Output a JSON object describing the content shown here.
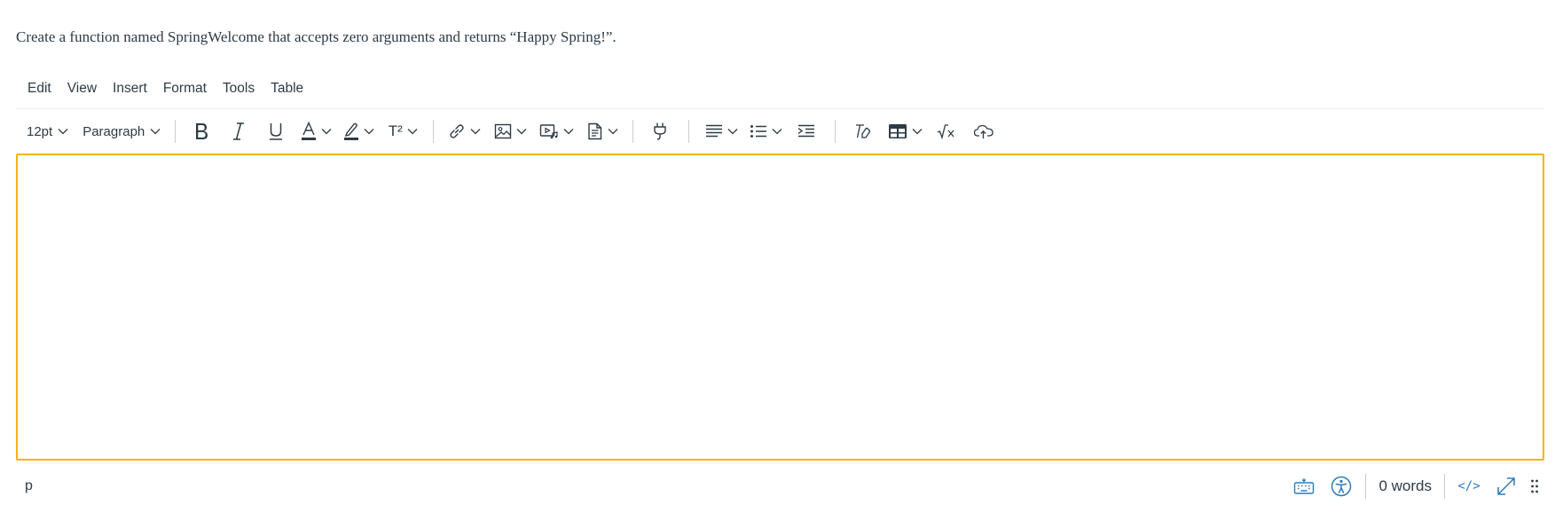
{
  "question": {
    "text": "Create a function named SpringWelcome that accepts zero arguments and returns “Happy Spring!”."
  },
  "menubar": {
    "items": [
      "Edit",
      "View",
      "Insert",
      "Format",
      "Tools",
      "Table"
    ]
  },
  "toolbar": {
    "font_size": "12pt",
    "block_format": "Paragraph",
    "superscript_label": "T²",
    "icons": [
      "bold-icon",
      "italic-icon",
      "underline-icon",
      "text-color-icon",
      "highlight-icon",
      "superscript-icon",
      "link-icon",
      "image-icon",
      "media-icon",
      "document-icon",
      "plug-icon",
      "align-icon",
      "list-icon",
      "indent-icon",
      "clear-format-icon",
      "table-icon",
      "math-icon",
      "cloud-upload-icon"
    ]
  },
  "content": {
    "text": ""
  },
  "statusbar": {
    "path": "p",
    "word_count": "0 words",
    "html_toggle": "</>"
  },
  "colors": {
    "focus_border": "#f5b40f",
    "accent": "#2b7abc",
    "text": "#2d3b45"
  }
}
